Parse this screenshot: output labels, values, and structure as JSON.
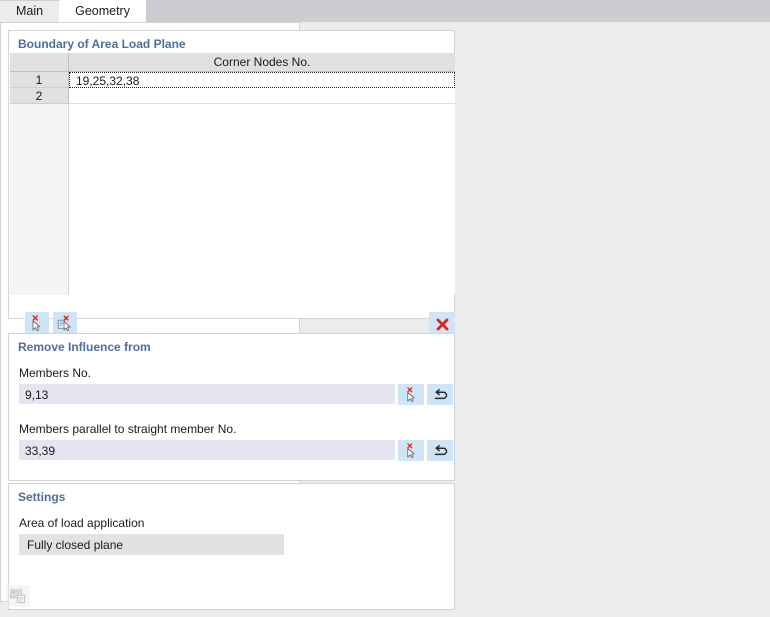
{
  "tabs": [
    {
      "label": "Main",
      "active": false
    },
    {
      "label": "Geometry",
      "active": true
    }
  ],
  "boundary_group": {
    "title": "Boundary of Area Load Plane",
    "table": {
      "row_header_blank": "",
      "column_header": "Corner Nodes No.",
      "rows": [
        {
          "number": "1",
          "corner_nodes": "19,25,32,38",
          "selected": true
        },
        {
          "number": "2",
          "corner_nodes": "",
          "selected": false
        }
      ]
    },
    "toolbar": {
      "pick_nodes_tooltip": "Select Nodes Graphically",
      "pick_lines_tooltip": "Select Lines Graphically",
      "delete_tooltip": "Delete Row"
    }
  },
  "remove_influence_group": {
    "title": "Remove Influence from",
    "members": {
      "label": "Members No.",
      "value": "9,13",
      "placeholder": ""
    },
    "parallel_members": {
      "label": "Members parallel to straight member No.",
      "value": "33,39",
      "placeholder": ""
    }
  },
  "settings_group": {
    "title": "Settings",
    "area_of_load_application": {
      "label": "Area of load application",
      "value": "Fully closed plane"
    }
  },
  "preview_panel": {
    "render_button_tooltip": "Render Preview"
  },
  "colors": {
    "section_header": "#4f6f96",
    "accent_button": "#cfe4f5",
    "delete_red": "#e2231a",
    "input_background": "#e4e5f0",
    "readonly_background": "#e2e2e2",
    "window_background": "#ececed",
    "tabstrip_background": "#cccdd1"
  },
  "icons": {
    "pick_nodes": "cursor-pick-node-icon",
    "pick_lines": "cursor-pick-line-icon",
    "delete": "red-x-icon",
    "reset": "undo-arrow-icon",
    "render": "render-copy-icon"
  }
}
